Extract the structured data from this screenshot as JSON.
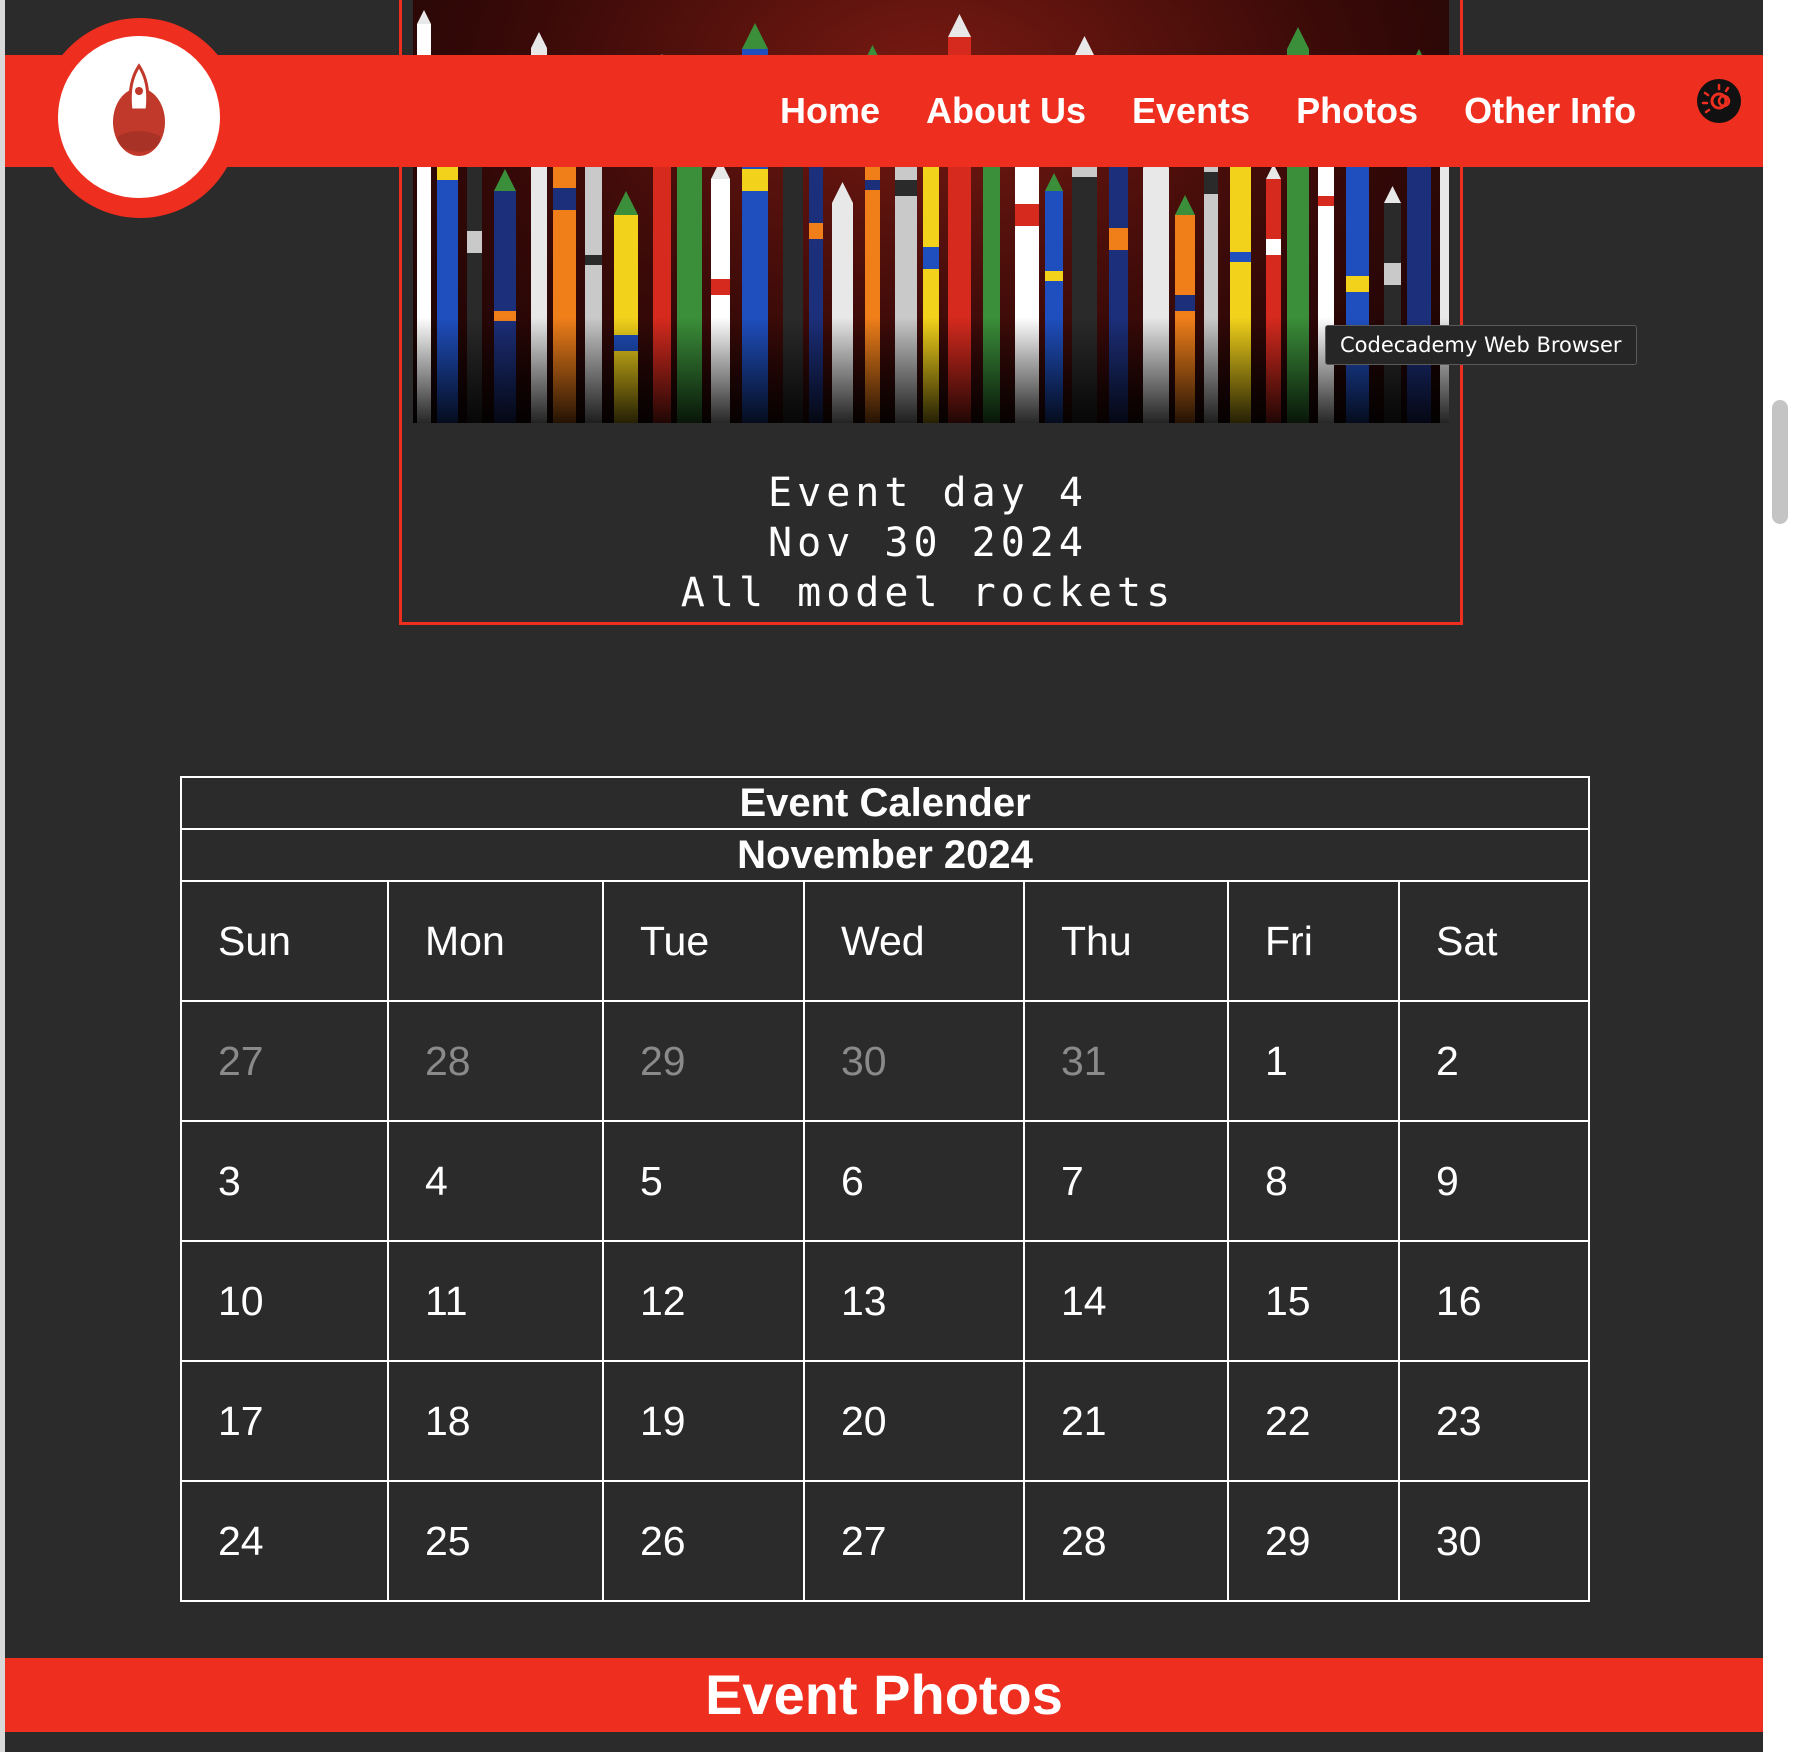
{
  "nav": {
    "links": [
      "Home",
      "About Us",
      "Events",
      "Photos",
      "Other Info"
    ]
  },
  "tooltip": "Codecademy Web Browser",
  "event": {
    "line1": "Event day 4",
    "line2": "Nov 30 2024",
    "line3": "All model rockets"
  },
  "calendar": {
    "title": "Event Calender",
    "month": "November 2024",
    "days": [
      "Sun",
      "Mon",
      "Tue",
      "Wed",
      "Thu",
      "Fri",
      "Sat"
    ],
    "weeks": [
      [
        "27",
        "28",
        "29",
        "30",
        "31",
        "1",
        "2"
      ],
      [
        "3",
        "4",
        "5",
        "6",
        "7",
        "8",
        "9"
      ],
      [
        "10",
        "11",
        "12",
        "13",
        "14",
        "15",
        "16"
      ],
      [
        "17",
        "18",
        "19",
        "20",
        "21",
        "22",
        "23"
      ],
      [
        "24",
        "25",
        "26",
        "27",
        "28",
        "29",
        "30"
      ]
    ]
  },
  "photos_heading": "Event Photos",
  "colors": {
    "accent": "#ee2e1f",
    "background": "#2b2b2b",
    "muted_day": "#8a8a8a"
  },
  "icons": [
    "rocket-logo-icon",
    "theme-toggle-icon"
  ]
}
